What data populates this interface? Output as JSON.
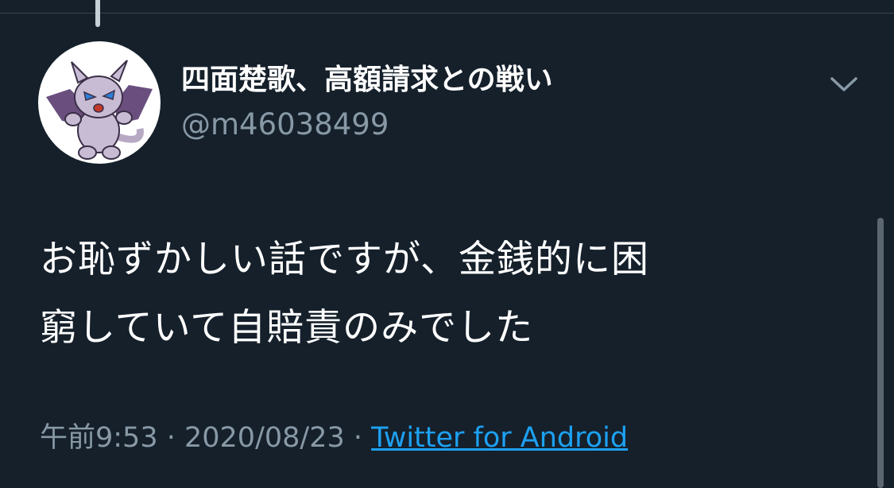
{
  "tweet": {
    "display_name": "四面楚歌、高額請求との戦い",
    "handle": "@m46038499",
    "text_line1": "お恥ずかしい話ですが、金銭的に困",
    "text_line2": "窮していて自賠責のみでした",
    "time": "午前9:53",
    "separator": " · ",
    "date": "2020/08/23",
    "source": "Twitter for Android"
  },
  "icons": {
    "more": "chevron-down-icon",
    "avatar": "purple-monster-avatar"
  },
  "colors": {
    "background": "#15202b",
    "text": "#ffffff",
    "secondary_text": "#8899a6",
    "link": "#1da1f2",
    "divider": "#38444d"
  }
}
